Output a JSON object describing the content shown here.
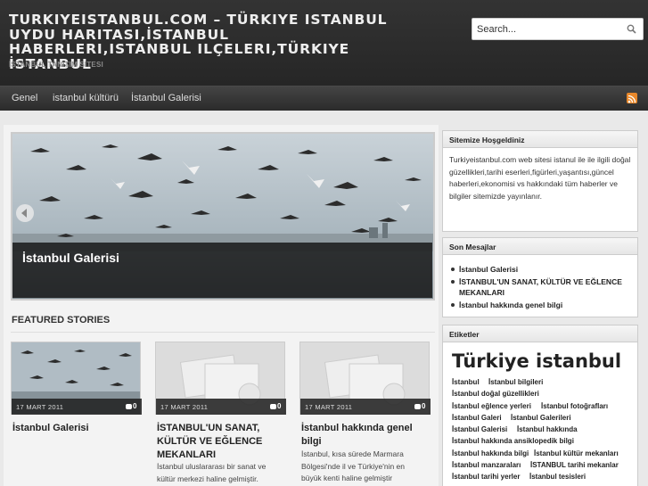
{
  "header": {
    "title": "TURKIYEISTANBUL.COM – TÜRKIYE ISTANBUL UYDU HARITASI,İSTANBUL HABERLERI,ISTANBUL ILÇELERI,TÜRKIYE İSTANBUL",
    "tagline": "İSTANBUL TANITIM SITESI",
    "search_placeholder": "Search..."
  },
  "nav": {
    "items": [
      "Genel",
      "istanbul kültürü",
      "İstanbul Galerisi"
    ],
    "rss_icon": "rss-icon"
  },
  "slider": {
    "caption": "İstanbul Galerisi",
    "prev_icon": "chevron-left-icon"
  },
  "featured": {
    "heading": "FEATURED STORIES",
    "cards": [
      {
        "date": "17 MART 2011",
        "comments": "0",
        "title": "İstanbul Galerisi",
        "excerpt": ""
      },
      {
        "date": "17 MART 2011",
        "comments": "0",
        "title": "İSTANBUL'UN SANAT, KÜLTÜR VE EĞLENCE MEKANLARI",
        "excerpt": "İstanbul uluslararası bir sanat ve kültür merkezi haline gelmiştir."
      },
      {
        "date": "17 MART 2011",
        "comments": "0",
        "title": "İstanbul hakkında genel bilgi",
        "excerpt": "İstanbul, kısa sürede Marmara Bölgesi'nde il ve Türkiye'nin en büyük kenti haline gelmiştir"
      }
    ]
  },
  "sidebar": {
    "welcome": {
      "title": "Sitemize Hoşgeldiniz",
      "text": "Turkiyeistanbul.com web sitesi istanul ile ile ilgili doğal güzellikleri,tarihi eserleri,figürleri,yaşantısı,güncel haberleri,ekonomisi vs hakkındaki tüm haberler ve bilgiler sitemizde yayınlanır."
    },
    "recent": {
      "title": "Son Mesajlar",
      "items": [
        "İstanbul Galerisi",
        "İSTANBUL'UN SANAT, KÜLTÜR VE EĞLENCE MEKANLARI",
        "İstanbul hakkında genel bilgi"
      ]
    },
    "tags": {
      "title": "Etiketler",
      "big": "Türkiye istanbul",
      "items": [
        "İstanbul",
        "İstanbul bilgileri",
        "İstanbul doğal güzellikleri",
        "İstanbul eğlence yerleri",
        "İstanbul fotoğrafları",
        "İstanbul Galeri",
        "İstanbul Galerileri",
        "İstanbul Galerisi",
        "İstanbul hakkında",
        "İstanbul hakkında ansiklopedik bilgi",
        "İstanbul hakkında bilgi",
        "İstanbul kültür mekanları",
        "İstanbul manzaraları",
        "İSTANBUL tarihi mekanlar",
        "İstanbul tarihi yerler",
        "İstanbul tesisleri"
      ]
    }
  },
  "colors": {
    "header_bg": "#2b2b2b",
    "nav_bg": "#333333",
    "rss_orange": "#e8882b",
    "page_bg": "#e9e9e9"
  }
}
